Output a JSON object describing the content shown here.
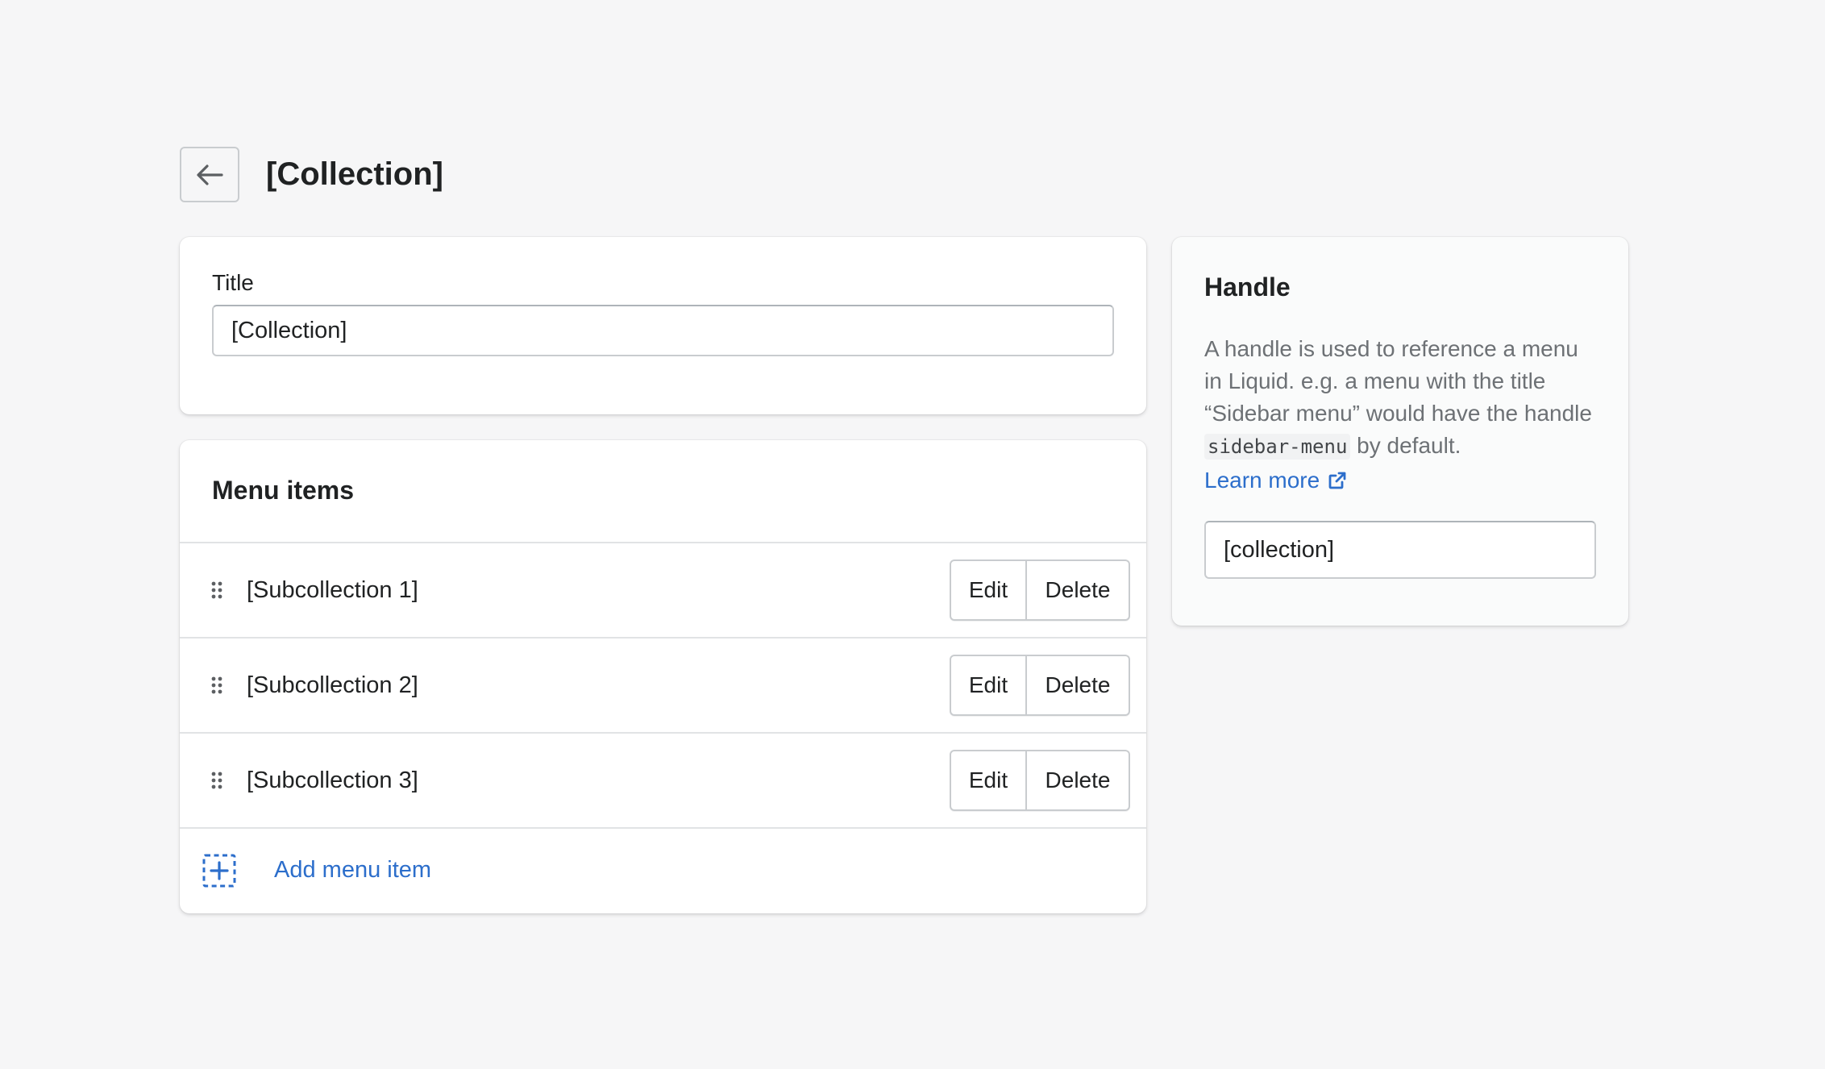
{
  "header": {
    "title": "[Collection]",
    "back_icon": "arrow-left-icon"
  },
  "title_card": {
    "label": "Title",
    "value": "[Collection]"
  },
  "menu_card": {
    "heading": "Menu items",
    "items": [
      {
        "label": "[Subcollection 1]",
        "edit_label": "Edit",
        "delete_label": "Delete"
      },
      {
        "label": "[Subcollection 2]",
        "edit_label": "Edit",
        "delete_label": "Delete"
      },
      {
        "label": "[Subcollection 3]",
        "edit_label": "Edit",
        "delete_label": "Delete"
      }
    ],
    "add_label": "Add menu item"
  },
  "handle_card": {
    "heading": "Handle",
    "description_before": "A handle is used to reference a menu in Liquid. e.g. a menu with the title “Sidebar menu” would have the handle",
    "code": "sidebar-menu",
    "description_after": "by default.",
    "learn_more": "Learn more",
    "value": "[collection]"
  },
  "colors": {
    "accent": "#2c6ecb",
    "background": "#f6f6f7",
    "card": "#ffffff",
    "text": "#202223",
    "subdued_text": "#6d7175"
  }
}
